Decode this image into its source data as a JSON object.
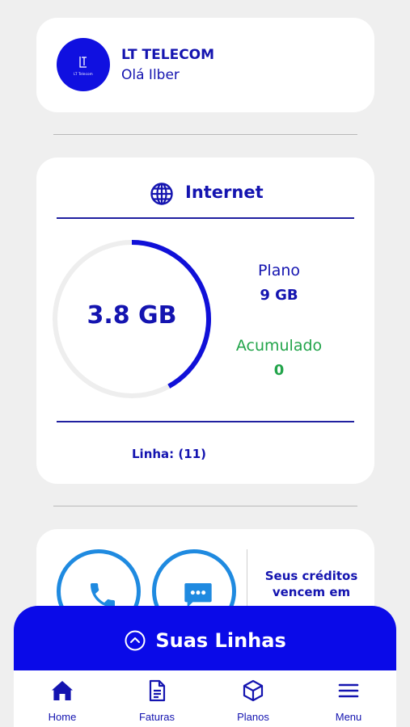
{
  "header": {
    "logo_text": "LT Telecom",
    "company": "LT TELECOM",
    "greeting": "Olá Ilber",
    "logo_icon": "lt-logo-icon"
  },
  "internet": {
    "title": "Internet",
    "icon": "globe-icon",
    "used": "3.8 GB",
    "usage_fraction": 0.42,
    "plan_label": "Plano",
    "plan_value": "9 GB",
    "accumulated_label": "Acumulado",
    "accumulated_value": "0",
    "line_info": "Linha: (11)"
  },
  "contact": {
    "phone_icon": "phone-icon",
    "chat_icon": "chat-icon",
    "credits_text": "Seus créditos vencem em"
  },
  "lines_panel": {
    "title": "Suas Linhas",
    "icon": "chevron-up-circle-icon"
  },
  "nav": {
    "items": [
      {
        "label": "Home",
        "icon": "home-icon"
      },
      {
        "label": "Faturas",
        "icon": "invoice-icon"
      },
      {
        "label": "Planos",
        "icon": "box-icon"
      },
      {
        "label": "Menu",
        "icon": "menu-icon"
      }
    ]
  },
  "colors": {
    "brand_blue": "#0a0ae8",
    "text_blue": "#1414b0",
    "ring_blue": "#1010d8",
    "accent_light_blue": "#1f8ae0",
    "green": "#22a44a",
    "background": "#efefef"
  }
}
